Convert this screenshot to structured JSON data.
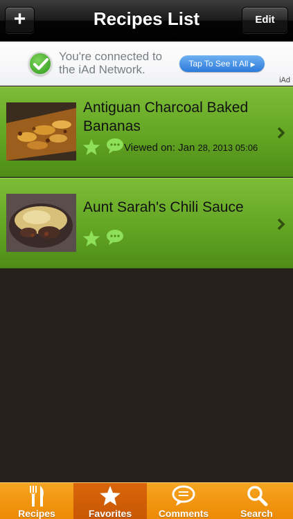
{
  "navbar": {
    "title": "Recipes List",
    "add_label": "+",
    "edit_label": "Edit"
  },
  "ad": {
    "message": "You're connected to the iAd Network.",
    "cta_label": "Tap To See It All",
    "brand": "iAd"
  },
  "recipes": [
    {
      "title": "Antiguan Charcoal Baked Bananas",
      "viewed_label": "Viewed on:",
      "viewed_month": "Jan",
      "viewed_date": "28, 2013 05:06"
    },
    {
      "title": "Aunt Sarah's Chili Sauce"
    }
  ],
  "tabs": [
    {
      "label": "Recipes",
      "icon": "fork-knife-icon"
    },
    {
      "label": "Favorites",
      "icon": "star-icon",
      "active": true
    },
    {
      "label": "Comments",
      "icon": "speech-bubble-icon"
    },
    {
      "label": "Search",
      "icon": "magnifier-icon"
    }
  ],
  "colors": {
    "navbar": "#1a1a1a",
    "cell_green": "#63a524",
    "tabbar_orange": "#f29611",
    "active_tab": "#d9660a",
    "background": "#26211c"
  }
}
